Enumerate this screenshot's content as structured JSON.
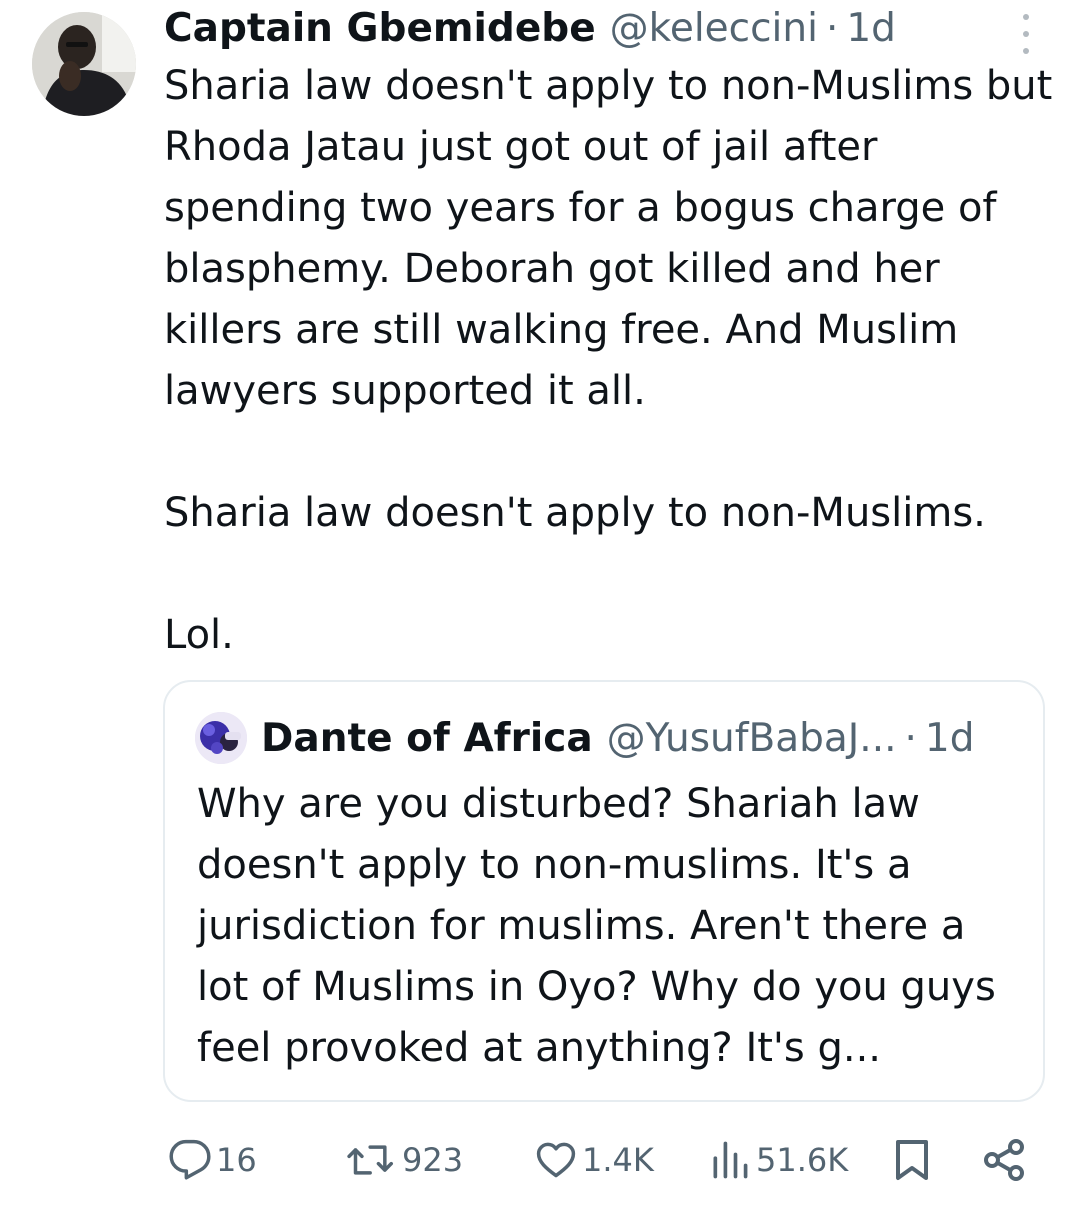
{
  "tweet": {
    "author": {
      "display_name": "Captain Gbemidebe",
      "handle": "@keleccini",
      "separator": "·",
      "time": "1d"
    },
    "paragraphs": [
      "Sharia law doesn't apply to non-Muslims but Rhoda Jatau just got out of jail after spending two years for a bogus charge of blasphemy. Deborah got killed and her killers are still walking free. And Muslim lawyers supported it all.",
      "Sharia law doesn't apply to non-Muslims.",
      "Lol."
    ],
    "quoted": {
      "display_name": "Dante of Africa",
      "handle": "@YusufBabaJ...",
      "separator": "·",
      "time": "1d",
      "text": "Why are you disturbed? Shariah law doesn't apply to non-muslims. It's a jurisdiction for muslims. Aren't there a lot of Muslims in Oyo? Why do you guys feel provoked at anything? It's g..."
    },
    "metrics": {
      "replies": "16",
      "reposts": "923",
      "likes": "1.4K",
      "views": "51.6K"
    }
  },
  "icons": {
    "more": "more-vertical-icon",
    "reply": "reply-icon",
    "repost": "repost-icon",
    "like": "heart-icon",
    "views": "views-bar-chart-icon",
    "bookmark": "bookmark-icon",
    "share": "share-icon"
  },
  "colors": {
    "text_primary": "#0f1419",
    "text_secondary": "#536471",
    "border": "#e6ecf0"
  }
}
